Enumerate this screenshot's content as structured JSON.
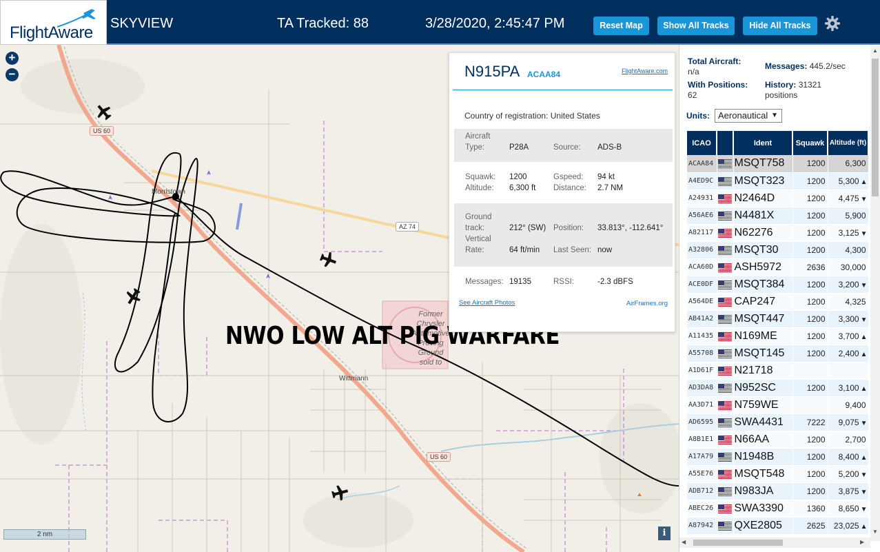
{
  "header": {
    "logo_text": "FlightAware",
    "app_name": "SKYVIEW",
    "tracked": "TA Tracked: 88",
    "datetime": "3/28/2020, 2:45:47 PM",
    "reset_label": "Reset Map",
    "show_all_label": "Show All Tracks",
    "hide_all_label": "Hide All Tracks",
    "gear_icon": "gear-icon"
  },
  "map": {
    "zoom_in": "+",
    "zoom_out": "−",
    "scale": "2 nm",
    "info": "i",
    "overlay_text": "NWO LOW ALT PIG WARFARE",
    "labels": {
      "us60_top": "US 60",
      "us60_bottom": "US 60",
      "az74": "AZ 74",
      "morristown": "Morristown",
      "wittmann": "Wittmann",
      "former": "Former Chrysler Automotive Proving Ground sold to developers"
    }
  },
  "popup": {
    "callsign": "N915PA",
    "hex": "ACAA84",
    "fa_link": "FlightAware.com",
    "country_label": "Country of registration:",
    "country_value": "United States",
    "aircraft_type_label": "Aircraft Type:",
    "aircraft_type_line1": "Aircraft",
    "aircraft_type_line2": "Type:",
    "aircraft_type": "P28A",
    "source_label": "Source:",
    "source": "ADS-B",
    "squawk_label": "Squawk:",
    "squawk": "1200",
    "altitude_label": "Altitude:",
    "altitude": "6,300 ft",
    "gspeed_label": "Gspeed:",
    "gspeed": "94 kt",
    "distance_label": "Distance:",
    "distance": "2.7 NM",
    "ground_track_line1": "Ground",
    "ground_track_line2": "track:",
    "ground_track": "212° (SW)",
    "position_label": "Position:",
    "position": "33.813°, -112.641°",
    "vertical_rate_line1": "Vertical",
    "vertical_rate_line2": "Rate:",
    "vertical_rate": "64 ft/min",
    "last_seen_label": "Last Seen:",
    "last_seen": "now",
    "messages_label": "Messages:",
    "messages": "19135",
    "rssi_label": "RSSI:",
    "rssi": "-2.3 dBFS",
    "photos_link": "See Aircraft Photos",
    "airframes_link": "AirFrames.org"
  },
  "sidebar": {
    "total_label": "Total Aircraft:",
    "total_value": "n/a",
    "messages_label": "Messages:",
    "messages_value": "445.2/sec",
    "positions_label": "With Positions:",
    "positions_value": "62",
    "history_label": "History:",
    "history_value": "31321",
    "history_unit": "positions",
    "units_label": "Units:",
    "units_value": "Aeronautical",
    "columns": [
      "ICAO",
      "",
      "Ident",
      "Squawk",
      "Altitude (ft)"
    ],
    "rows": [
      {
        "icao": "ACAA84",
        "ident": "MSQT758",
        "squawk": "1200",
        "alt": "6,300",
        "trend": ""
      },
      {
        "icao": "A4ED9C",
        "ident": "MSQT323",
        "squawk": "1200",
        "alt": "5,300",
        "trend": "▲"
      },
      {
        "icao": "A24931",
        "ident": "N2464D",
        "squawk": "1200",
        "alt": "4,475",
        "trend": "▼"
      },
      {
        "icao": "A56AE6",
        "ident": "N4481X",
        "squawk": "1200",
        "alt": "5,900",
        "trend": ""
      },
      {
        "icao": "A82117",
        "ident": "N62276",
        "squawk": "1200",
        "alt": "3,125",
        "trend": "▼"
      },
      {
        "icao": "A32806",
        "ident": "MSQT30",
        "squawk": "1200",
        "alt": "4,300",
        "trend": ""
      },
      {
        "icao": "ACA60D",
        "ident": "ASH5972",
        "squawk": "2636",
        "alt": "30,000",
        "trend": ""
      },
      {
        "icao": "ACE0DF",
        "ident": "MSQT384",
        "squawk": "1200",
        "alt": "3,200",
        "trend": "▼"
      },
      {
        "icao": "A564DE",
        "ident": "CAP247",
        "squawk": "1200",
        "alt": "4,325",
        "trend": ""
      },
      {
        "icao": "AB41A2",
        "ident": "MSQT447",
        "squawk": "1200",
        "alt": "3,300",
        "trend": "▼"
      },
      {
        "icao": "A11435",
        "ident": "N169ME",
        "squawk": "1200",
        "alt": "3,700",
        "trend": "▲"
      },
      {
        "icao": "A55708",
        "ident": "MSQT145",
        "squawk": "1200",
        "alt": "2,400",
        "trend": "▲"
      },
      {
        "icao": "A1D61F",
        "ident": "N21718",
        "squawk": "",
        "alt": "",
        "trend": ""
      },
      {
        "icao": "AD3DA8",
        "ident": "N952SC",
        "squawk": "1200",
        "alt": "3,100",
        "trend": "▲"
      },
      {
        "icao": "AA3D71",
        "ident": "N759WE",
        "squawk": "",
        "alt": "9,400",
        "trend": ""
      },
      {
        "icao": "AD6595",
        "ident": "SWA4431",
        "squawk": "7222",
        "alt": "9,075",
        "trend": "▼"
      },
      {
        "icao": "A8B1E1",
        "ident": "N66AA",
        "squawk": "1200",
        "alt": "2,700",
        "trend": ""
      },
      {
        "icao": "A17A79",
        "ident": "N1948B",
        "squawk": "1200",
        "alt": "8,400",
        "trend": "▲"
      },
      {
        "icao": "A55E76",
        "ident": "MSQT548",
        "squawk": "1200",
        "alt": "5,200",
        "trend": "▼"
      },
      {
        "icao": "ADB712",
        "ident": "N983JA",
        "squawk": "1200",
        "alt": "3,875",
        "trend": "▼"
      },
      {
        "icao": "ABEC26",
        "ident": "SWA3390",
        "squawk": "1360",
        "alt": "8,650",
        "trend": "▼"
      },
      {
        "icao": "A87942",
        "ident": "QXE2805",
        "squawk": "2625",
        "alt": "23,025",
        "trend": "▲"
      }
    ]
  },
  "colors": {
    "header_bg": "#002f5d",
    "button_bg": "#1a96d8",
    "map_bg": "#f1efe8",
    "highway": "#f2a88e",
    "track": "#000000"
  }
}
